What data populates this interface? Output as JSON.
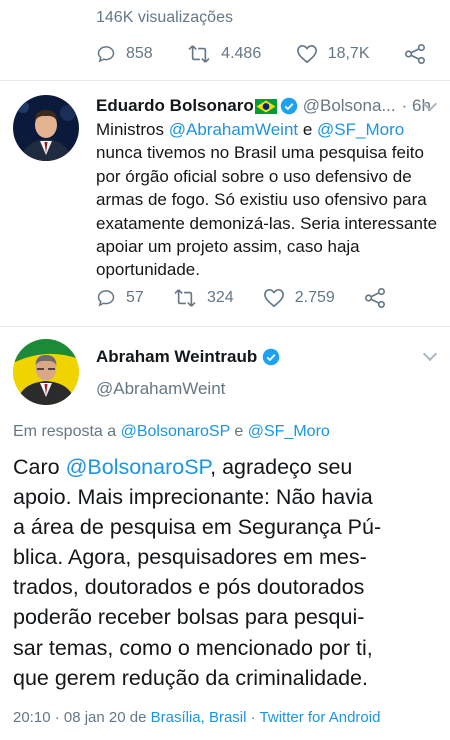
{
  "top_tweet": {
    "views": "146K visualizações",
    "replies": "858",
    "retweets": "4.486",
    "likes": "18,7K"
  },
  "reply_tweet": {
    "name": "Eduardo Bolsonaro",
    "flag_icon": "brazil-flag-icon",
    "handle": "@Bolsona...",
    "time": "· 6h",
    "text_prefix": "Ministros ",
    "mention1": "@AbrahamWeint",
    "text_and": " e ",
    "mention2": "@SF_Moro",
    "text_lines": [
      "nunca tivemos no Brasil uma pesquisa feito",
      "por órgão oficial sobre o uso defensivo de",
      "armas de fogo. Só existiu uso ofensivo para",
      "exatamente demonizá-las. Seria interessante",
      "apoiar um projeto assim, caso haja",
      "oportunidade."
    ],
    "replies": "57",
    "retweets": "324",
    "likes": "2.759"
  },
  "main_tweet": {
    "name": "Abraham Weintraub",
    "handle": "@AbrahamWeint",
    "reply_prefix": "Em resposta a ",
    "reply_mention1": "@BolsonaroSP",
    "reply_and": " e ",
    "reply_mention2": "@SF_Moro",
    "line1_prefix": "Caro ",
    "line1_mention": "@BolsonaroSP",
    "line1_suffix": ", agradeço seu",
    "lines": [
      "apoio. Mais imprecionante: Não havia",
      "a área de pesquisa em Segurança Pú-",
      "blica. Agora, pesquisadores em mes-",
      "trados, doutorados e pós doutorados",
      "poderão receber bolsas para pesqui-",
      "sar temas, como o mencionado por ti,",
      "que gerem redução da criminalidade."
    ],
    "timestamp": "20:10 · 08 jan 20 de ",
    "location": "Brasília, Brasil",
    "sep": " · ",
    "client": "Twitter for Android"
  },
  "colors": {
    "link": "#1b95e0",
    "gray": "#657786",
    "verified": "#1da1f2"
  }
}
